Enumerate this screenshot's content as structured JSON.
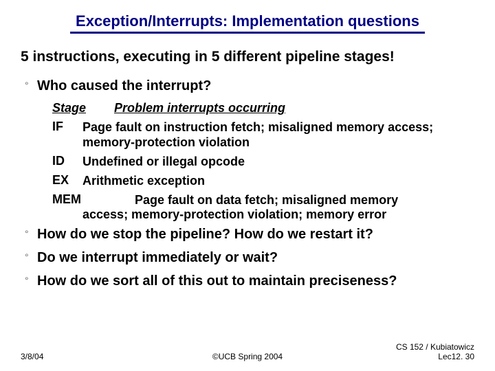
{
  "title": "Exception/Interrupts: Implementation questions",
  "subhead": "5 instructions, executing in 5 different pipeline stages!",
  "bullet_mark": "°",
  "bullets": {
    "b1": "Who caused the interrupt?",
    "b2": "How do we stop the pipeline?  How do we restart it?",
    "b3": "Do we interrupt immediately or wait?",
    "b4": "How do we sort all of this out to maintain preciseness?"
  },
  "table": {
    "head_stage": "Stage",
    "head_problem": "Problem interrupts occurring",
    "rows": {
      "if_stage": "IF",
      "if_text": "Page fault on instruction fetch; misaligned memory access; memory-protection violation",
      "id_stage": "ID",
      "id_text": "Undefined or illegal opcode",
      "ex_stage": "EX",
      "ex_text": "Arithmetic exception",
      "mem_stage": "MEM",
      "mem_text_a": "Page fault on data fetch; misaligned memory",
      "mem_text_b": "access; memory-protection violation; memory error"
    }
  },
  "footer": {
    "left": "3/8/04",
    "center": "©UCB Spring 2004",
    "right": "CS 152 / Kubiatowicz\nLec12. 30"
  }
}
